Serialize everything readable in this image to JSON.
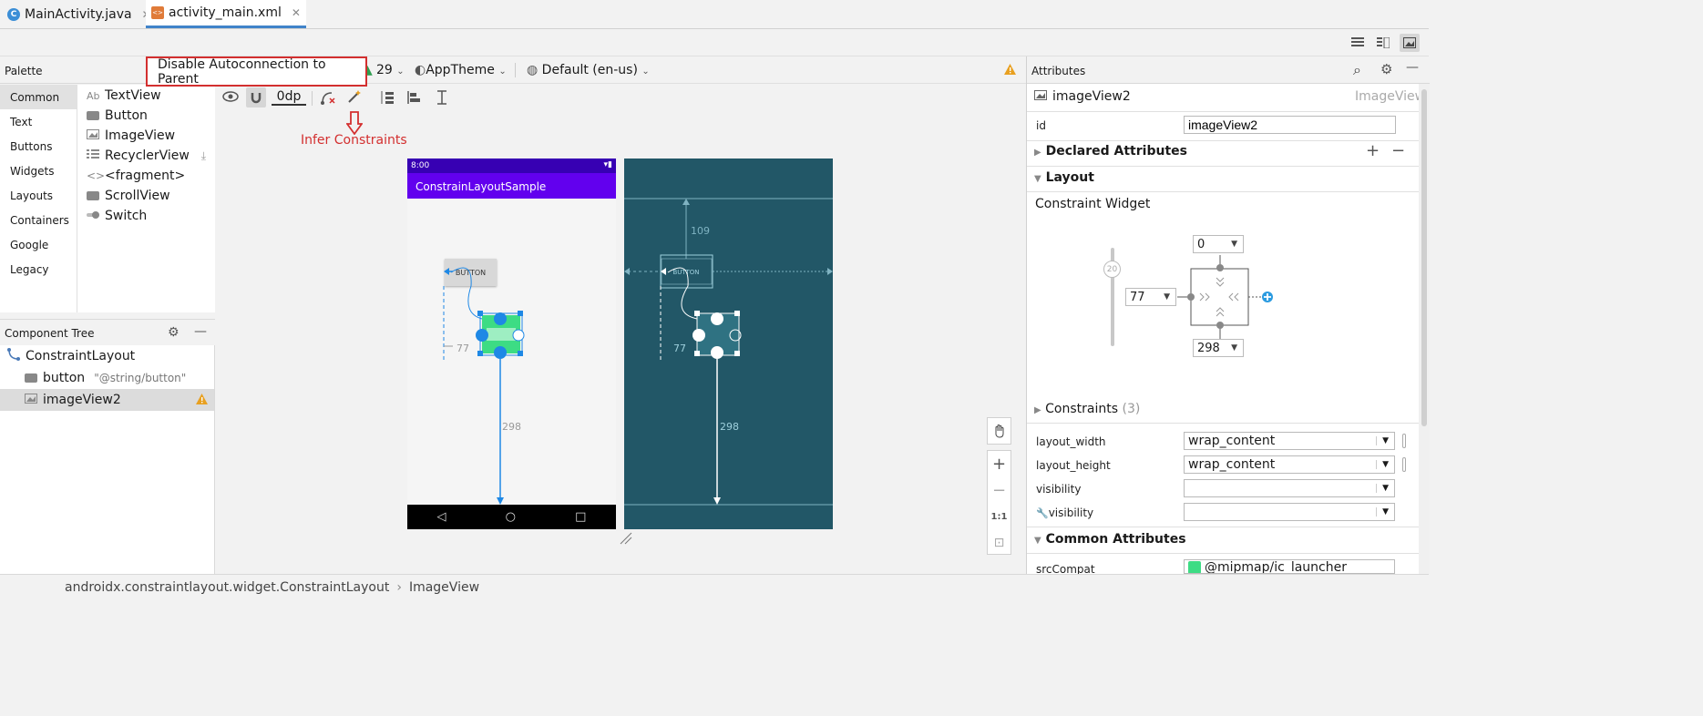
{
  "tabs": [
    {
      "label": "MainActivity.java",
      "icon": "java-class-icon"
    },
    {
      "label": "activity_main.xml",
      "icon": "xml-layout-icon",
      "active": true
    }
  ],
  "palette": {
    "title": "Palette",
    "categories": [
      "Common",
      "Text",
      "Buttons",
      "Widgets",
      "Layouts",
      "Containers",
      "Google",
      "Legacy"
    ],
    "items": [
      {
        "label": "TextView",
        "prefix": "Ab"
      },
      {
        "label": "Button"
      },
      {
        "label": "ImageView"
      },
      {
        "label": "RecyclerView"
      },
      {
        "label": "<fragment>"
      },
      {
        "label": "ScrollView"
      },
      {
        "label": "Switch"
      }
    ]
  },
  "tree": {
    "title": "Component Tree",
    "rows": [
      {
        "label": "ConstraintLayout"
      },
      {
        "label": "button",
        "hint": "\"@string/button\""
      },
      {
        "label": "imageView2"
      }
    ]
  },
  "toolbar": {
    "tooltip": "Disable Autoconnection to Parent",
    "api_level": "29",
    "theme": "AppTheme",
    "locale": "Default (en-us)",
    "margin": "0dp",
    "annotation": "Infer Constraints"
  },
  "preview": {
    "status_time": "8:00",
    "app_title": "ConstrainLayoutSample",
    "button_text": "BUTTON",
    "label_top": "109",
    "label_left": "77",
    "label_bottom": "298"
  },
  "attributes": {
    "title": "Attributes",
    "view_name": "imageView2",
    "view_type": "ImageView",
    "id_label": "id",
    "id_value": "imageView2",
    "declared": "Declared Attributes",
    "layout": "Layout",
    "constraint_widget": "Constraint Widget",
    "bias": "20",
    "top_margin": "0",
    "left_margin": "77",
    "bottom_margin": "298",
    "constraints_label": "Constraints",
    "constraints_count": "(3)",
    "layout_width_label": "layout_width",
    "layout_width_value": "wrap_content",
    "layout_height_label": "layout_height",
    "layout_height_value": "wrap_content",
    "visibility_label": "visibility",
    "tools_visibility_label": "visibility",
    "common": "Common Attributes",
    "src_label": "srcCompat",
    "src_value": "@mipmap/ic_launcher"
  },
  "zoom": {
    "fit": "1:1"
  },
  "statusbar": {
    "path1": "androidx.constraintlayout.widget.ConstraintLayout",
    "sep": "›",
    "path2": "ImageView"
  },
  "colors": {
    "accent": "#4083c9",
    "annotation": "#d32f2f",
    "blueprint": "#225767",
    "appbar": "#6200ee",
    "statusbar": "#3700b3"
  }
}
